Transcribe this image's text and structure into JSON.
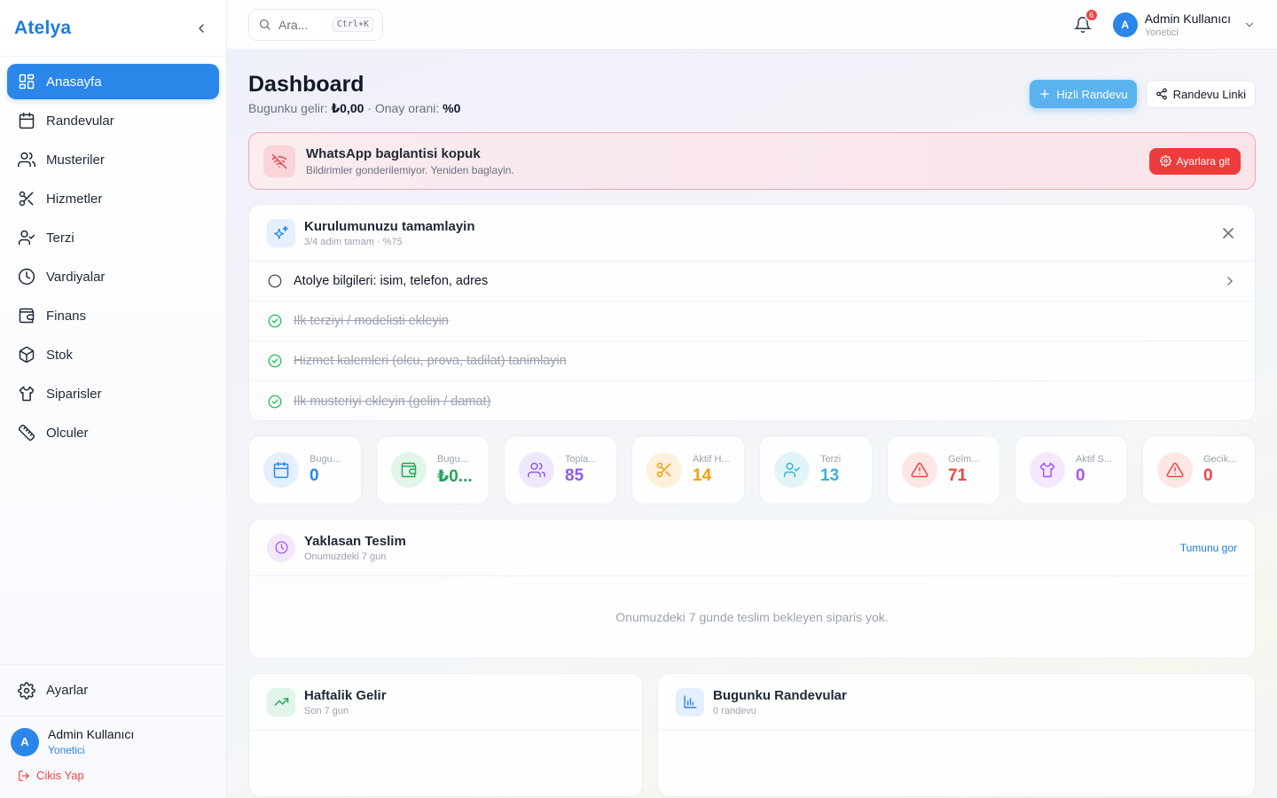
{
  "app": {
    "brand": "Atelya"
  },
  "sidebar": {
    "items": [
      {
        "label": "Anasayfa",
        "icon": "dashboard-icon",
        "active": true
      },
      {
        "label": "Randevular",
        "icon": "calendar-icon"
      },
      {
        "label": "Musteriler",
        "icon": "users-icon"
      },
      {
        "label": "Hizmetler",
        "icon": "scissors-icon"
      },
      {
        "label": "Terzi",
        "icon": "user-check-icon"
      },
      {
        "label": "Vardiyalar",
        "icon": "clock-icon"
      },
      {
        "label": "Finans",
        "icon": "wallet-icon"
      },
      {
        "label": "Stok",
        "icon": "box-icon"
      },
      {
        "label": "Siparisler",
        "icon": "shirt-icon"
      },
      {
        "label": "Olculer",
        "icon": "ruler-icon"
      }
    ],
    "settings_label": "Ayarlar",
    "user": {
      "initial": "A",
      "name": "Admin Kullanıcı",
      "role": "Yonetici"
    },
    "logout_label": "Cikis Yap"
  },
  "topbar": {
    "search_placeholder": "Ara...",
    "search_shortcut": "Ctrl+K",
    "notification_count": "6",
    "user": {
      "initial": "A",
      "name": "Admin Kullanıcı",
      "role": "Yonetici"
    }
  },
  "header": {
    "title": "Dashboard",
    "income_label": "Bugunku gelir:",
    "income_value": "₺0,00",
    "separator": "·",
    "approval_label": "Onay orani:",
    "approval_value": "%0",
    "quick_btn": "Hizli Randevu",
    "link_btn": "Randevu Linki"
  },
  "alert": {
    "title": "WhatsApp baglantisi kopuk",
    "text": "Bildirimler gonderilemiyor. Yeniden baglayin.",
    "button": "Ayarlara git"
  },
  "setup": {
    "title": "Kurulumunuzu tamamlayin",
    "progress": "3/4 adim tamam · %75",
    "steps": [
      {
        "label": "Atolye bilgileri: isim, telefon, adres",
        "done": false
      },
      {
        "label": "Ilk terziyi / modelisti ekleyin",
        "done": true
      },
      {
        "label": "Hizmet kalemleri (olcu, prova, tadilat) tanimlayin",
        "done": true
      },
      {
        "label": "Ilk musteriyi ekleyin (gelin / damat)",
        "done": true
      }
    ]
  },
  "stats": [
    {
      "label": "Bugu...",
      "value": "0",
      "color": "#2b86ea",
      "bg": "#e4efff",
      "icon": "calendar-icon"
    },
    {
      "label": "Bugu...",
      "value": "₺0...",
      "color": "#22a55a",
      "bg": "#e1f5e8",
      "icon": "wallet-icon"
    },
    {
      "label": "Topla...",
      "value": "85",
      "color": "#8b5cf6",
      "bg": "#efe8fd",
      "icon": "users-icon"
    },
    {
      "label": "Aktif H...",
      "value": "14",
      "color": "#f59e0b",
      "bg": "#fdf1dc",
      "icon": "scissors-icon"
    },
    {
      "label": "Terzi",
      "value": "13",
      "color": "#38b2d8",
      "bg": "#e2f4fa",
      "icon": "user-check-icon"
    },
    {
      "label": "Gelm...",
      "value": "71",
      "color": "#ef4444",
      "bg": "#fde6e6",
      "icon": "alert-triangle-icon"
    },
    {
      "label": "Aktif S...",
      "value": "0",
      "color": "#a855f7",
      "bg": "#f3e8fd",
      "icon": "shirt-icon"
    },
    {
      "label": "Gecik...",
      "value": "0",
      "color": "#ef4444",
      "bg": "#fde6e6",
      "icon": "alert-triangle-icon"
    }
  ],
  "upcoming": {
    "title": "Yaklasan Teslim",
    "subtitle": "Onumuzdeki 7 gun",
    "link": "Tumunu gor",
    "empty": "Onumuzdeki 7 gunde teslim bekleyen siparis yok."
  },
  "weekly": {
    "title": "Haftalik Gelir",
    "subtitle": "Son 7 gun"
  },
  "today": {
    "title": "Bugunku Randevular",
    "subtitle": "0 randevu"
  },
  "colors": {
    "accent": "#2b86ea",
    "danger": "#ef3b3b",
    "success": "#22c55e"
  }
}
